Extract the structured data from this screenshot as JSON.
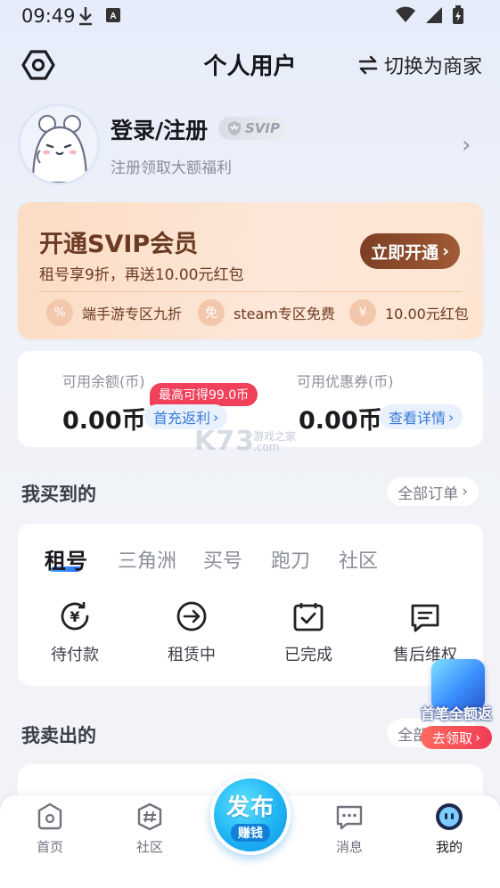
{
  "status_bar": {
    "time": "09:49"
  },
  "header": {
    "title": "个人用户",
    "switch_label": "切换为商家"
  },
  "profile": {
    "login_text": "登录/注册",
    "svip_badge": "SVIP",
    "subtitle": "注册领取大额福利"
  },
  "svip_card": {
    "title": "开通SVIP会员",
    "subtitle": "租号享9折，再送10.00元红包",
    "button": "立即开通",
    "perks": [
      "端手游专区九折",
      "steam专区免费",
      "10.00元红包"
    ]
  },
  "balance": {
    "balance_label": "可用余额(币)",
    "balance_value": "0.00币",
    "max_badge": "最高可得99.0币",
    "recharge_link": "首充返利",
    "coupon_label": "可用优惠券(币)",
    "coupon_value": "0.00币",
    "coupon_link": "查看详情"
  },
  "watermark": {
    "main": "K73",
    "sub": "游戏之家\n.com"
  },
  "bought": {
    "title": "我买到的",
    "all_orders": "全部订单",
    "tabs": [
      "租号",
      "三角洲",
      "买号",
      "跑刀",
      "社区"
    ],
    "items": [
      "待付款",
      "租赁中",
      "已完成",
      "售后维权"
    ]
  },
  "sold": {
    "title": "我卖出的",
    "all_orders": "全部订单"
  },
  "promo": {
    "text": "首笔全额返",
    "button": "去领取"
  },
  "bottom_nav": {
    "items": [
      "首页",
      "社区",
      "消息",
      "我的"
    ],
    "publish_main": "发布",
    "publish_sub": "赚钱"
  },
  "colors": {
    "accent_blue": "#3a7bd8",
    "svip_brown": "#6b3a22",
    "badge_red": "#f0405a"
  }
}
